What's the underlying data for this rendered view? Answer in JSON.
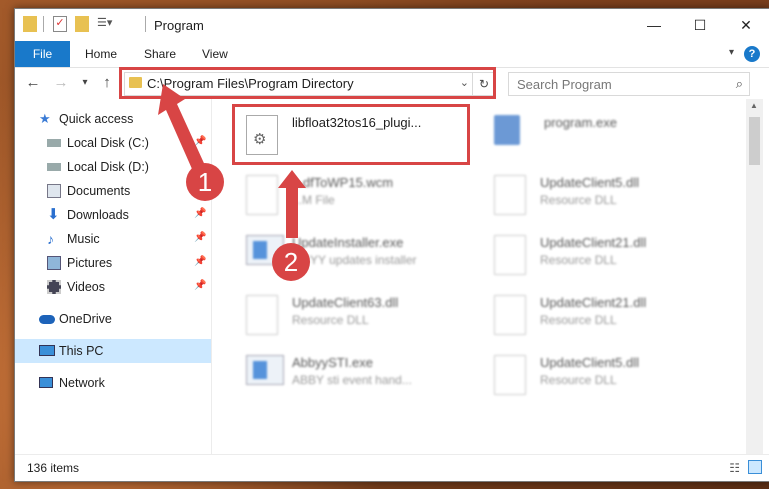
{
  "window": {
    "title": "Program",
    "ribbon_tabs": [
      "File",
      "Home",
      "Share",
      "View"
    ],
    "help": "?"
  },
  "nav": {
    "address": "C:\\Program Files\\Program Directory",
    "search_placeholder": "Search Program"
  },
  "sidebar": {
    "items": [
      {
        "label": "Quick access",
        "icon": "star-icon"
      },
      {
        "label": "Local Disk (C:)",
        "icon": "disk-icon"
      },
      {
        "label": "Local Disk (D:)",
        "icon": "disk-icon"
      },
      {
        "label": "Documents",
        "icon": "documents-icon"
      },
      {
        "label": "Downloads",
        "icon": "download-icon"
      },
      {
        "label": "Music",
        "icon": "music-icon"
      },
      {
        "label": "Pictures",
        "icon": "pictures-icon"
      },
      {
        "label": "Videos",
        "icon": "videos-icon"
      },
      {
        "label": "OneDrive",
        "icon": "cloud-icon"
      },
      {
        "label": "This PC",
        "icon": "computer-icon"
      },
      {
        "label": "Network",
        "icon": "network-icon"
      }
    ]
  },
  "files": [
    {
      "name": "libfloat32tos16_plugi...",
      "type": ""
    },
    {
      "name": "program.exe",
      "type": ""
    },
    {
      "name": "...dfToWP15.wcm",
      "type": "...M File"
    },
    {
      "name": "UpdateClient5.dll",
      "type": "Resource DLL"
    },
    {
      "name": "UpdateInstaller.exe",
      "type": "...BYY updates installer"
    },
    {
      "name": "UpdateClient21.dll",
      "type": "Resource DLL"
    },
    {
      "name": "UpdateClient63.dll",
      "type": "Resource DLL"
    },
    {
      "name": "UpdateClient21.dll",
      "type": "Resource DLL"
    },
    {
      "name": "AbbyySTI.exe",
      "type": "ABBY sti event hand..."
    },
    {
      "name": "UpdateClient5.dll",
      "type": "Resource DLL"
    }
  ],
  "status": {
    "count": "136 items"
  },
  "annotations": {
    "step1": "1",
    "step2": "2",
    "color": "#d84545"
  }
}
